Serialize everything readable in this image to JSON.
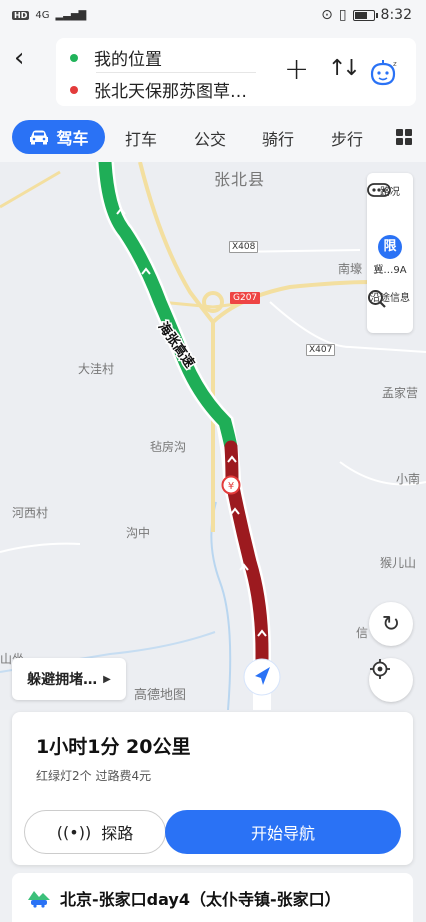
{
  "status_bar": {
    "network": "4G",
    "time": "8:32",
    "battery_level": 0.6
  },
  "header": {
    "origin": "我的位置",
    "destination": "张北天保那苏图草…",
    "origin_color": "#21b35a",
    "destination_color": "#e33b3b"
  },
  "tabs": {
    "active": "驾车",
    "items": [
      "打车",
      "公交",
      "骑行",
      "步行"
    ]
  },
  "map": {
    "county_label": "张北县",
    "places": [
      "大洼村",
      "毡房沟",
      "河西村",
      "沟中",
      "孟家营",
      "小南",
      "猴儿山",
      "南壕",
      "信",
      "堡",
      "山坐"
    ],
    "roads": [
      "X408",
      "G207",
      "X407"
    ],
    "highway_label": "海张高速",
    "traffic_colors": {
      "smooth": "#1fae57",
      "jam": "#9c1a1f"
    },
    "right_panel": {
      "traffic": "路况",
      "limit_badge": "限",
      "limit_text": "冀…9A",
      "along_info": "沿途信息"
    },
    "avoid_button": "躲避拥堵…",
    "logo": "高德地图"
  },
  "route_card": {
    "summary": "1小时1分  20公里",
    "details": "红绿灯2个  过路费4元",
    "probe_button": "探路",
    "start_button": "开始导航"
  },
  "bottom_strip": {
    "trip_title": "北京-张家口day4（太仆寺镇-张家口）"
  }
}
